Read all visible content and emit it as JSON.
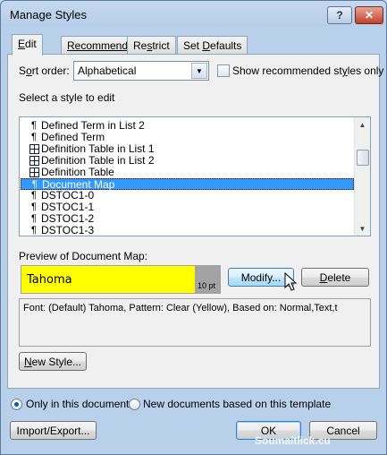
{
  "window": {
    "title": "Manage Styles",
    "help_label": "?",
    "close_label": "✕"
  },
  "tabs": [
    {
      "label_u": "E",
      "label_rest": "dit"
    },
    {
      "label_u": "",
      "label_rest": "Recommend"
    },
    {
      "label_pre": "Re",
      "label_u": "s",
      "label_rest": "trict"
    },
    {
      "label_pre": "Set ",
      "label_u": "D",
      "label_rest": "efaults"
    }
  ],
  "sort": {
    "label_pre": "S",
    "label_u": "o",
    "label_rest": "rt order:",
    "value": "Alphabetical",
    "dropdown_glyph": "▼"
  },
  "show_recommended": {
    "label_pre": "Show recommended st",
    "label_u": "y",
    "label_rest": "les only",
    "checked": false
  },
  "select_label": "Select a style to edit",
  "styles": [
    {
      "name": "Defined Term in List 2",
      "icon": "paragraph-icon",
      "glyph": "¶"
    },
    {
      "name": "Defined Term",
      "icon": "paragraph-icon",
      "glyph": "¶"
    },
    {
      "name": "Definition Table in List 1",
      "icon": "table-icon",
      "glyph": ""
    },
    {
      "name": "Definition Table in List 2",
      "icon": "table-icon",
      "glyph": ""
    },
    {
      "name": "Definition Table",
      "icon": "table-icon",
      "glyph": ""
    },
    {
      "name": "Document Map",
      "icon": "paragraph-icon",
      "glyph": "¶",
      "selected": true
    },
    {
      "name": "DSTOC1-0",
      "icon": "paragraph-icon",
      "glyph": "¶"
    },
    {
      "name": "DSTOC1-1",
      "icon": "paragraph-icon",
      "glyph": "¶"
    },
    {
      "name": "DSTOC1-2",
      "icon": "paragraph-icon",
      "glyph": "¶"
    },
    {
      "name": "DSTOC1-3",
      "icon": "paragraph-icon",
      "glyph": "¶"
    }
  ],
  "scroll": {
    "up": "▲",
    "down": "▼"
  },
  "preview": {
    "label": "Preview of Document Map:",
    "font_name": "Tahoma",
    "size": "10 pt",
    "color": "#ffff00"
  },
  "buttons": {
    "modify": "Modify...",
    "delete_u": "D",
    "delete_rest": "elete",
    "new_style_u": "N",
    "new_style_rest": "ew Style...",
    "import_export": "Import/Export...",
    "ok": "OK",
    "cancel": "Cancel"
  },
  "description": "Font: (Default) Tahoma, Pattern: Clear (Yellow), Based on: Normal,Text,t",
  "scope": {
    "only_this": "Only in this document",
    "new_docs": "New documents based on this template",
    "selected": "only_this"
  },
  "watermark": "Soumaitlick.cu"
}
